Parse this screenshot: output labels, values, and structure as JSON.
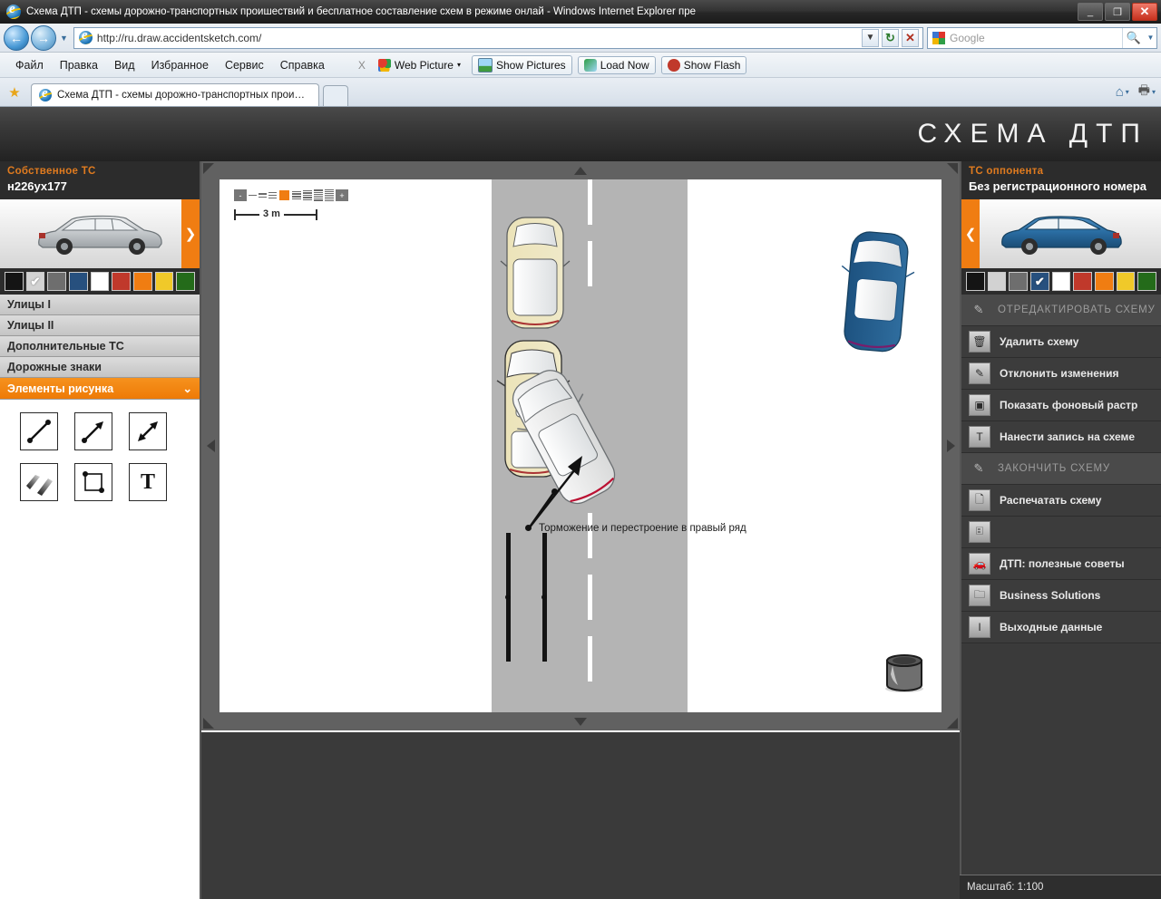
{
  "window": {
    "title": "Схема ДТП - схемы дорожно-транспортных проишествий и бесплатное составление схем в режиме онлай - Windows Internet Explorer пре",
    "minimize": "_",
    "maximize": "❐",
    "close": "✕"
  },
  "address": {
    "back": "←",
    "forward": "→",
    "history_caret": "▼",
    "url": "http://ru.draw.accidentsketch.com/",
    "url_dropdown": "▼",
    "refresh": "↻",
    "stop": "✕",
    "search_placeholder": "Google",
    "search_go": "🔍",
    "search_caret": "▼"
  },
  "menu": {
    "items": [
      "Файл",
      "Правка",
      "Вид",
      "Избранное",
      "Сервис",
      "Справка"
    ],
    "separator": "X",
    "webpicture": {
      "label": "Web Picture",
      "caret": "▾"
    },
    "buttons": [
      {
        "label": "Show Pictures",
        "icon": "image-icon"
      },
      {
        "label": "Load Now",
        "icon": "refresh-icon"
      },
      {
        "label": "Show Flash",
        "icon": "flash-icon"
      }
    ]
  },
  "tabs": {
    "favorites_star": "★",
    "active_tab": "Схема ДТП - схемы дорожно-транспортных проиш…",
    "new_tab": "",
    "home": "⌂",
    "print": "🖶",
    "caret": "▾"
  },
  "banner": {
    "title": "СХЕМА ДТП"
  },
  "left_panel": {
    "vehicle": {
      "subtitle": "Собственное ТС",
      "plate": "н226ух177",
      "arrow": "❯",
      "car_color": "#c9cdd1"
    },
    "swatches": [
      {
        "name": "black",
        "hex": "#141414",
        "selected": false
      },
      {
        "name": "silver",
        "hex": "#d2d2d2",
        "selected": true
      },
      {
        "name": "gray",
        "hex": "#6e6e6e",
        "selected": false
      },
      {
        "name": "blue",
        "hex": "#27507e",
        "selected": false
      },
      {
        "name": "white",
        "hex": "#ffffff",
        "selected": false
      },
      {
        "name": "red",
        "hex": "#c0392b",
        "selected": false
      },
      {
        "name": "orange",
        "hex": "#f07d12",
        "selected": false
      },
      {
        "name": "yellow",
        "hex": "#f0c929",
        "selected": false
      },
      {
        "name": "green",
        "hex": "#246b1a",
        "selected": false
      }
    ],
    "accordion": [
      {
        "label": "Улицы I",
        "active": false
      },
      {
        "label": "Улицы II",
        "active": false
      },
      {
        "label": "Дополнительные ТС",
        "active": false
      },
      {
        "label": "Дорожные знаки",
        "active": false
      },
      {
        "label": "Элементы рисунка",
        "active": true,
        "caret": "⌄"
      }
    ],
    "tools": [
      {
        "name": "line-tool",
        "glyph": "line"
      },
      {
        "name": "arrow-tool",
        "glyph": "arrow"
      },
      {
        "name": "double-arrow-tool",
        "glyph": "double-arrow"
      },
      {
        "name": "skidmark-tool",
        "glyph": "skid"
      },
      {
        "name": "rectangle-tool",
        "glyph": "rect"
      },
      {
        "name": "text-tool",
        "glyph": "T"
      }
    ]
  },
  "right_panel": {
    "vehicle": {
      "subtitle": "ТС оппонента",
      "plate": "Без регистрационного номера",
      "arrow": "❮",
      "car_color": "#2b6ca3"
    },
    "swatches": [
      {
        "name": "black",
        "hex": "#141414",
        "selected": false
      },
      {
        "name": "silver",
        "hex": "#d2d2d2",
        "selected": false
      },
      {
        "name": "gray",
        "hex": "#6e6e6e",
        "selected": false
      },
      {
        "name": "blue",
        "hex": "#27507e",
        "selected": true
      },
      {
        "name": "white",
        "hex": "#ffffff",
        "selected": false
      },
      {
        "name": "red",
        "hex": "#c0392b",
        "selected": false
      },
      {
        "name": "orange",
        "hex": "#f07d12",
        "selected": false
      },
      {
        "name": "yellow",
        "hex": "#f0c929",
        "selected": false
      },
      {
        "name": "green",
        "hex": "#246b1a",
        "selected": false
      }
    ],
    "menu": [
      {
        "label": "ОТРЕДАКТИРОВАТЬ СХЕМУ",
        "icon": "pencil-icon",
        "disabled": true
      },
      {
        "label": "Удалить схему",
        "icon": "trash-icon",
        "disabled": false
      },
      {
        "label": "Отклонить изменения",
        "icon": "undo-pencil-icon",
        "disabled": false
      },
      {
        "label": "Показать фоновый растр",
        "icon": "raster-icon",
        "disabled": false
      },
      {
        "label": "Нанести запись на схеме",
        "icon": "text-icon",
        "disabled": false
      },
      {
        "label": "ЗАКОНЧИТЬ СХЕМУ",
        "icon": "pencil-icon",
        "disabled": true
      },
      {
        "label": "Распечатать схему",
        "icon": "page-icon",
        "disabled": false
      },
      {
        "label": "",
        "icon": "comment-icon",
        "disabled": false
      },
      {
        "label": "ДТП: полезные советы",
        "icon": "car-icon",
        "disabled": false
      },
      {
        "label": "Business Solutions",
        "icon": "folder-icon",
        "disabled": false
      },
      {
        "label": "Выходные данные",
        "icon": "info-icon",
        "disabled": false
      }
    ]
  },
  "canvas": {
    "zoom": {
      "minus": "-",
      "plus": "+",
      "selected_step": 3
    },
    "ruler_label": "3 m",
    "annotation": "Торможение и перестроение в правый ряд",
    "pan": {
      "up": "▲",
      "down": "▼",
      "left": "◀",
      "right": "▶"
    },
    "bin": "trash-bin-icon",
    "vehicles": [
      {
        "name": "beige-car-upper",
        "color": "#eee6c0"
      },
      {
        "name": "beige-car-lower",
        "color": "#e8e0b6"
      },
      {
        "name": "silver-car-rotated",
        "color": "#e9e9e9"
      },
      {
        "name": "blue-car",
        "color": "#26608f"
      }
    ]
  },
  "status": {
    "scale": "Масштаб: 1:100"
  }
}
